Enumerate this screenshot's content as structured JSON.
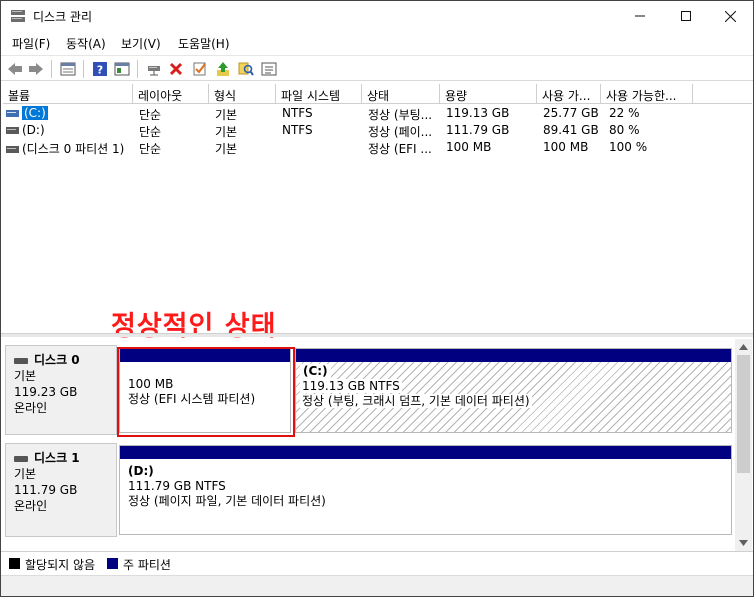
{
  "window": {
    "title": "디스크 관리"
  },
  "menu": [
    "파일(F)",
    "동작(A)",
    "보기(V)",
    "도움말(H)"
  ],
  "toolbar": {
    "icons": [
      "back-icon",
      "forward-icon",
      "properties-list-icon",
      "help-icon",
      "console-tree-icon",
      "connect-icon",
      "delete-icon",
      "check-icon",
      "up-icon",
      "search-icon",
      "details-icon"
    ]
  },
  "volume_list": {
    "columns": [
      "볼륨",
      "레이아웃",
      "형식",
      "파일 시스템",
      "상태",
      "용량",
      "사용 가...",
      "사용 가능한..."
    ],
    "rows": [
      {
        "volume": "(C:)",
        "layout": "단순",
        "type": "기본",
        "fs": "NTFS",
        "status": "정상 (부팅...",
        "capacity": "119.13 GB",
        "free": "25.77 GB",
        "pct": "22 %",
        "selected": true
      },
      {
        "volume": "(D:)",
        "layout": "단순",
        "type": "기본",
        "fs": "NTFS",
        "status": "정상 (페이...",
        "capacity": "111.79 GB",
        "free": "89.41 GB",
        "pct": "80 %",
        "selected": false
      },
      {
        "volume": "(디스크 0 파티션 1)",
        "layout": "단순",
        "type": "기본",
        "fs": "",
        "status": "정상 (EFI ...",
        "capacity": "100 MB",
        "free": "100 MB",
        "pct": "100 %",
        "selected": false
      }
    ]
  },
  "annotation": "정상적인 상태",
  "disks": [
    {
      "name": "디스크 0",
      "type": "기본",
      "size": "119.23 GB",
      "status": "온라인",
      "partitions": [
        {
          "label": "",
          "size": "100 MB",
          "desc": "정상 (EFI 시스템 파티션)"
        },
        {
          "label": "(C:)",
          "size": "119.13 GB NTFS",
          "desc": "정상 (부팅, 크래시 덤프, 기본 데이터 파티션)"
        }
      ]
    },
    {
      "name": "디스크 1",
      "type": "기본",
      "size": "111.79 GB",
      "status": "온라인",
      "partitions": [
        {
          "label": "(D:)",
          "size": "111.79 GB NTFS",
          "desc": "정상 (페이지 파일, 기본 데이터 파티션)"
        }
      ]
    }
  ],
  "legend": [
    {
      "label": "할당되지 않음",
      "color": "#000000"
    },
    {
      "label": "주 파티션",
      "color": "#000080"
    }
  ],
  "colors": {
    "partition_bar": "#000080",
    "annotation": "#ff1a1a",
    "selection": "#0078d7"
  }
}
